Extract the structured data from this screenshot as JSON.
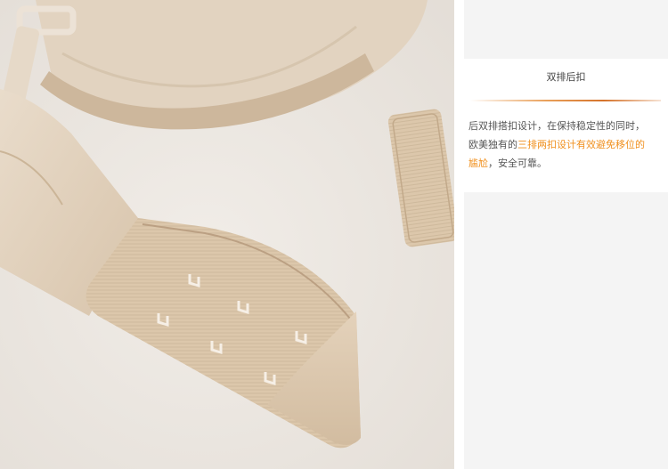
{
  "panel": {
    "heading": "双排后扣",
    "desc_line1": "后双排搭扣设计，在保持稳定性的同时，",
    "desc_line2_a": "欧美独有的",
    "desc_line2_b": "三排两扣设计有效避免移位的",
    "desc_line3_a": "尴尬",
    "desc_line3_b": "，安全可靠。"
  },
  "colors": {
    "highlight": "#f0901e",
    "fabric": "#dcc9b2",
    "background": "#ece7e1"
  }
}
